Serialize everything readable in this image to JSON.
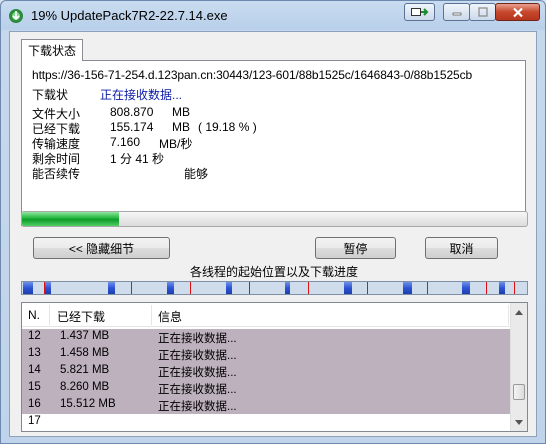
{
  "window": {
    "title": "19% UpdatePack7R2-22.7.14.exe"
  },
  "tab": {
    "label": "下载状态"
  },
  "info": {
    "url": "https://36-156-71-254.d.123pan.cn:30443/123-601/88b1525c/1646843-0/88b1525cb",
    "status_label": "下载状",
    "status_value": "正在接收数据...",
    "file_size_label": "文件大小",
    "file_size_value": "808.870",
    "file_size_unit": "MB",
    "downloaded_label": "已经下载",
    "downloaded_value": "155.174",
    "downloaded_unit": "MB",
    "downloaded_percent": "( 19.18 % )",
    "speed_label": "传输速度",
    "speed_value": "7.160",
    "speed_unit": "MB/秒",
    "remaining_label": "剩余时间",
    "remaining_value": "1 分 41 秒",
    "resume_label": "能否续传",
    "resume_value": "能够"
  },
  "progress": {
    "percent": 19.18
  },
  "buttons": {
    "hide_details": "<< 隐藏细节",
    "pause": "暂停",
    "cancel": "取消"
  },
  "threads_label": "各线程的起始位置以及下载进度",
  "thread_segments": [
    {
      "start": 0.2,
      "done": 2.0
    },
    {
      "start": 4.3,
      "done": 1.5
    },
    {
      "start": 17.0,
      "done": 1.4
    },
    {
      "start": 28.7,
      "done": 1.5
    },
    {
      "start": 40.4,
      "done": 1.2
    },
    {
      "start": 52.0,
      "done": 1.0
    },
    {
      "start": 63.7,
      "done": 1.6
    },
    {
      "start": 75.4,
      "done": 1.9
    },
    {
      "start": 87.1,
      "done": 1.7
    },
    {
      "start": 94.4,
      "done": 1.3
    }
  ],
  "thread_markers": [
    4.4,
    21.6,
    33.3,
    45.0,
    56.7,
    68.4,
    80.1,
    91.8,
    97.5
  ],
  "colors": {
    "progress_fill": "#1fb43a",
    "segment_fill": "#2c55d4",
    "marker": "#d11",
    "row_highlight": "#bdb1bd"
  },
  "table": {
    "columns": [
      "N.",
      "已经下载",
      "信息"
    ],
    "rows": [
      {
        "n": "12",
        "downloaded": "1.437 MB",
        "info": "正在接收数据..."
      },
      {
        "n": "13",
        "downloaded": "1.458 MB",
        "info": "正在接收数据..."
      },
      {
        "n": "14",
        "downloaded": "5.821 MB",
        "info": "正在接收数据..."
      },
      {
        "n": "15",
        "downloaded": "8.260 MB",
        "info": "正在接收数据..."
      },
      {
        "n": "16",
        "downloaded": "15.512 MB",
        "info": "正在接收数据..."
      },
      {
        "n": "17",
        "downloaded": "",
        "info": ""
      }
    ]
  }
}
